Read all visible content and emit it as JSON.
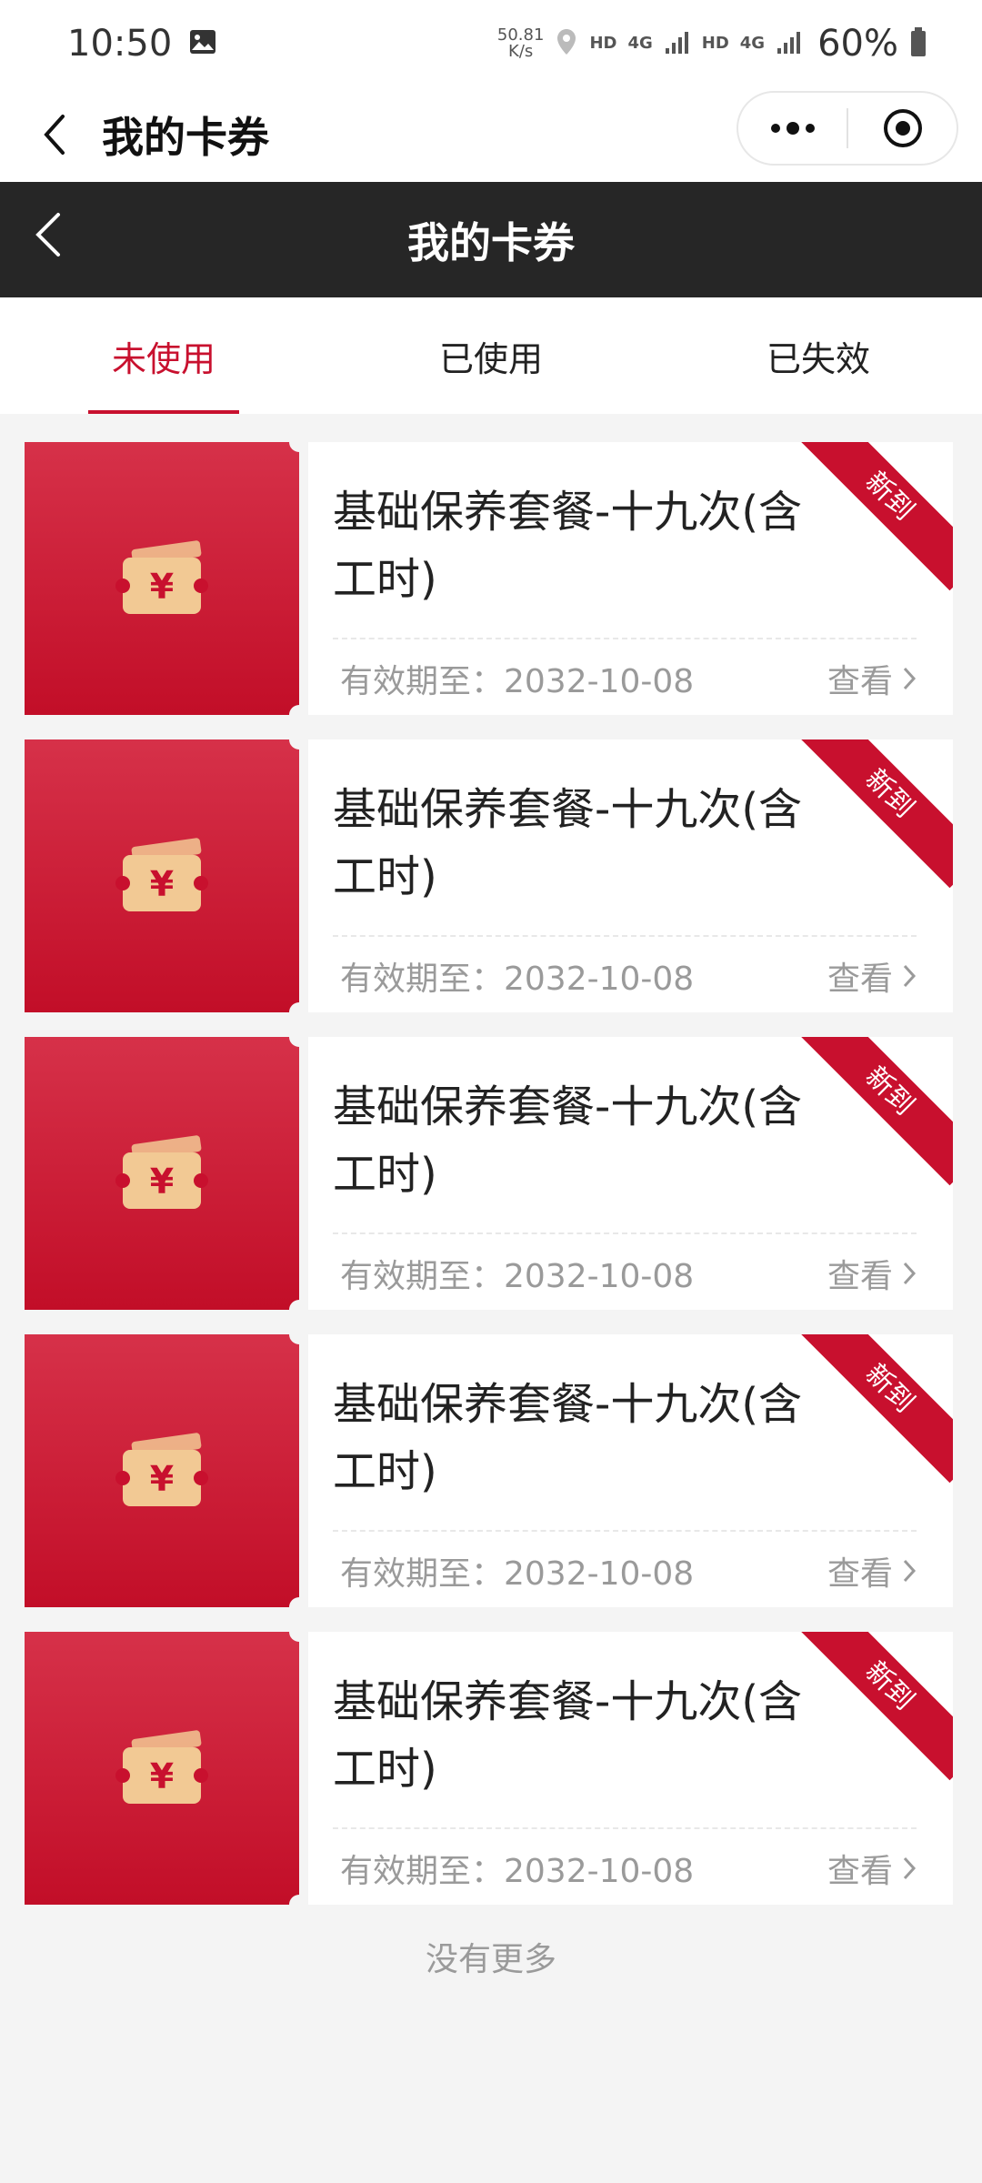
{
  "status_bar": {
    "time": "10:50",
    "net_speed_value": "50.81",
    "net_speed_unit": "K/s",
    "hd1": "HD",
    "net1": "4G",
    "hd2": "HD",
    "net2": "4G",
    "battery": "60%"
  },
  "mp_nav": {
    "title": "我的卡券"
  },
  "header": {
    "title": "我的卡券"
  },
  "tabs": [
    {
      "label": "未使用",
      "active": true
    },
    {
      "label": "已使用",
      "active": false
    },
    {
      "label": "已失效",
      "active": false
    }
  ],
  "coupons": [
    {
      "title": "基础保养套餐-十九次(含工时)",
      "expiry": "有效期至：2032-10-08",
      "view": "查看",
      "badge": "新到"
    },
    {
      "title": "基础保养套餐-十九次(含工时)",
      "expiry": "有效期至：2032-10-08",
      "view": "查看",
      "badge": "新到"
    },
    {
      "title": "基础保养套餐-十九次(含工时)",
      "expiry": "有效期至：2032-10-08",
      "view": "查看",
      "badge": "新到"
    },
    {
      "title": "基础保养套餐-十九次(含工时)",
      "expiry": "有效期至：2032-10-08",
      "view": "查看",
      "badge": "新到"
    },
    {
      "title": "基础保养套餐-十九次(含工时)",
      "expiry": "有效期至：2032-10-08",
      "view": "查看",
      "badge": "新到"
    }
  ],
  "coupon_icon_symbol": "¥",
  "footer": {
    "no_more": "没有更多"
  },
  "colors": {
    "accent": "#c8102e",
    "header_bg": "#262626",
    "coupon_icon": "#f2c994"
  }
}
